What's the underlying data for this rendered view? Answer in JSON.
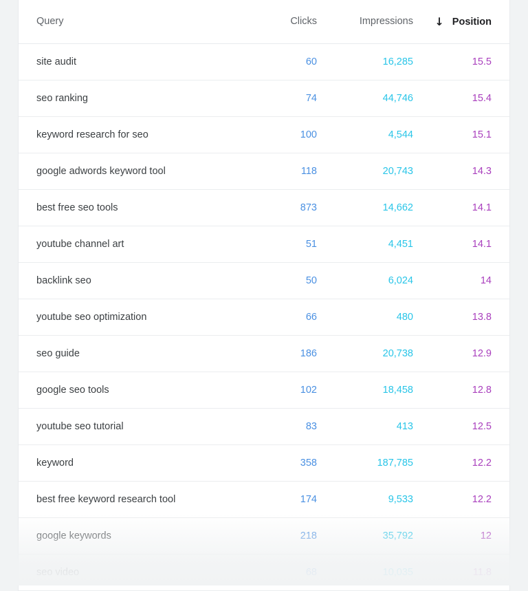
{
  "table": {
    "columns": [
      {
        "key": "query",
        "label": "Query",
        "align": "left",
        "sorted": false
      },
      {
        "key": "clicks",
        "label": "Clicks",
        "align": "right",
        "sorted": false
      },
      {
        "key": "impressions",
        "label": "Impressions",
        "align": "right",
        "sorted": false
      },
      {
        "key": "position",
        "label": "Position",
        "align": "right",
        "sorted": true
      }
    ],
    "sort": {
      "column": "Position",
      "direction": "descending",
      "icon": "arrow-down-icon",
      "glyph": "↓"
    },
    "colors": {
      "query": "#3c4043",
      "clicks": "#4a90e2",
      "impressions": "#29c5e8",
      "position": "#a93fbd",
      "header": "#5f6368",
      "header_active": "#202124",
      "page_background": "#f1f3f4",
      "card_background": "#ffffff",
      "row_divider": "#ebedef"
    },
    "rows": [
      {
        "query": "site audit",
        "clicks": "60",
        "impressions": "16,285",
        "position": "15.5"
      },
      {
        "query": "seo ranking",
        "clicks": "74",
        "impressions": "44,746",
        "position": "15.4"
      },
      {
        "query": "keyword research for seo",
        "clicks": "100",
        "impressions": "4,544",
        "position": "15.1"
      },
      {
        "query": "google adwords keyword tool",
        "clicks": "118",
        "impressions": "20,743",
        "position": "14.3"
      },
      {
        "query": "best free seo tools",
        "clicks": "873",
        "impressions": "14,662",
        "position": "14.1"
      },
      {
        "query": "youtube channel art",
        "clicks": "51",
        "impressions": "4,451",
        "position": "14.1"
      },
      {
        "query": "backlink seo",
        "clicks": "50",
        "impressions": "6,024",
        "position": "14"
      },
      {
        "query": "youtube seo optimization",
        "clicks": "66",
        "impressions": "480",
        "position": "13.8"
      },
      {
        "query": "seo guide",
        "clicks": "186",
        "impressions": "20,738",
        "position": "12.9"
      },
      {
        "query": "google seo tools",
        "clicks": "102",
        "impressions": "18,458",
        "position": "12.8"
      },
      {
        "query": "youtube seo tutorial",
        "clicks": "83",
        "impressions": "413",
        "position": "12.5"
      },
      {
        "query": "keyword",
        "clicks": "358",
        "impressions": "187,785",
        "position": "12.2"
      },
      {
        "query": "best free keyword research tool",
        "clicks": "174",
        "impressions": "9,533",
        "position": "12.2"
      },
      {
        "query": "google keywords",
        "clicks": "218",
        "impressions": "35,792",
        "position": "12"
      },
      {
        "query": "seo video",
        "clicks": "68",
        "impressions": "10,035",
        "position": "11.8"
      }
    ]
  }
}
